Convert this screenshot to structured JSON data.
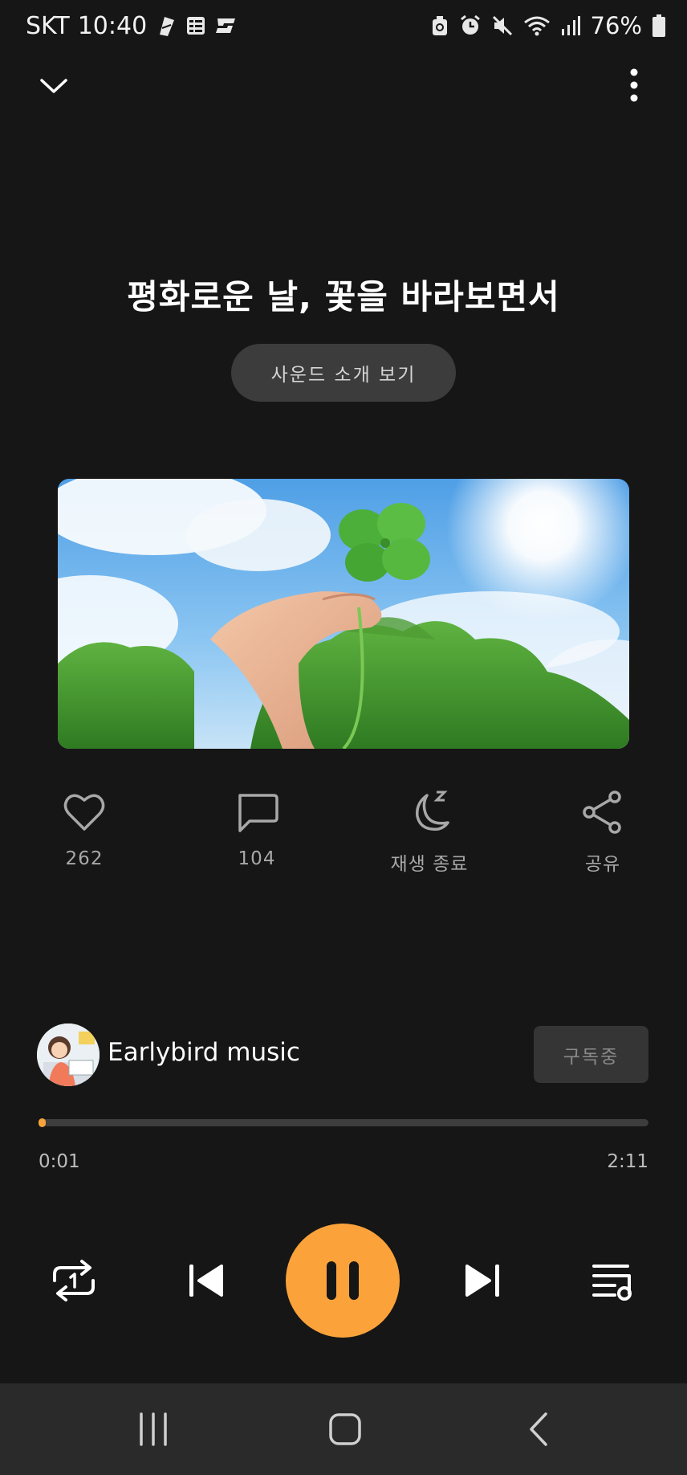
{
  "status_bar": {
    "carrier": "SKT",
    "time": "10:40",
    "battery": "76%"
  },
  "player": {
    "title": "평화로운 날, 꽃을 바라보면서",
    "intro_button": "사운드 소개 보기"
  },
  "actions": {
    "like_count": "262",
    "comment_count": "104",
    "sleep_label": "재생 종료",
    "share_label": "공유"
  },
  "channel": {
    "name": "Earlybird music",
    "subscribe_label": "구독중"
  },
  "progress": {
    "current": "0:01",
    "total": "2:11",
    "fraction": 0.008
  },
  "colors": {
    "accent": "#fba33a",
    "background": "#161616"
  }
}
